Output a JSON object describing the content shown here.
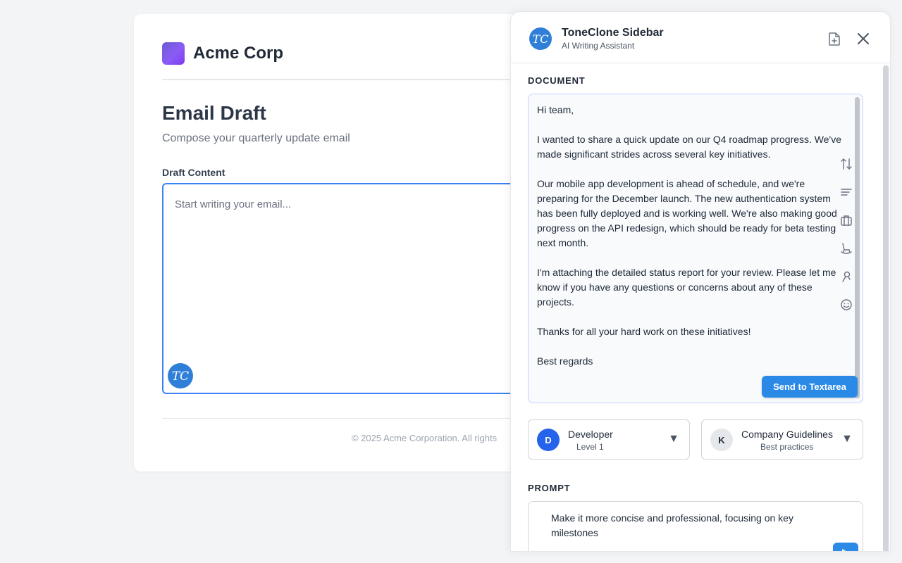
{
  "page": {
    "brand_name": "Acme Corp",
    "title": "Email Draft",
    "subtitle": "Compose your quarterly update email",
    "field_label": "Draft Content",
    "draft_placeholder": "Start writing your email...",
    "badge_initials": "TC",
    "footer": "© 2025 Acme Corporation. All rights"
  },
  "sidebar": {
    "logo_initials": "TC",
    "title": "ToneClone Sidebar",
    "subtitle": "AI Writing Assistant",
    "icons": [
      "new-document-icon",
      "close-icon"
    ],
    "document_label": "DOCUMENT",
    "document_text": "Hi team,\n\nI wanted to share a quick update on our Q4 roadmap progress. We've made significant strides across several key initiatives.\n\nOur mobile app development is ahead of schedule, and we're preparing for the December launch. The new authentication system has been fully deployed and is working well. We're also making good progress on the API redesign, which should be ready for beta testing next month.\n\nI'm attaching the detailed status report for your review. Please let me know if you have any questions or concerns about any of these projects.\n\nThanks for all your hard work on these initiatives!\n\nBest regards",
    "doc_tools": [
      "sort-arrows-icon",
      "align-lines-icon",
      "briefcase-icon",
      "rocking-chair-icon",
      "pin-icon",
      "smiley-icon"
    ],
    "send_button": "Send to Textarea",
    "persona": {
      "initial": "D",
      "name": "Developer",
      "level": "Level 1",
      "color": "#2563eb"
    },
    "knowledge": {
      "initial": "K",
      "name": "Company Guidelines",
      "desc": "Best practices",
      "color": "#e5e7eb"
    },
    "prompt_label": "PROMPT",
    "prompt_text": "Make it more concise and professional, focusing on key milestones"
  },
  "colors": {
    "accent": "#2b8ae6",
    "focus_border": "#3b82f6",
    "brand_gradient_start": "#6d5bd0",
    "brand_gradient_end": "#7c3aed"
  }
}
